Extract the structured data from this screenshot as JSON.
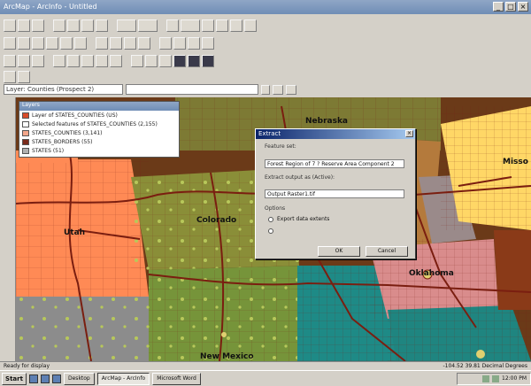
{
  "window": {
    "title": "ArcMap - ArcInfo - Untitled",
    "controls": [
      "_",
      "□",
      "×"
    ]
  },
  "toolbar": {
    "layer_selector": "Layer: Counties (Prospect 2)",
    "combo2": ""
  },
  "map_labels": {
    "nebraska": "Nebraska",
    "colorado": "Colorado",
    "utah": "Utah",
    "oklahoma": "Oklahoma",
    "new_mexico": "New Mexico",
    "missouri": "Misso"
  },
  "layers": {
    "panel_title": "Layers",
    "items": [
      {
        "label": "Layer of STATES_COUNTIES (US)",
        "color": "#d84b2a"
      },
      {
        "label": "Selected features of STATES_COUNTIES (2,155)",
        "color": "#ffffff"
      },
      {
        "label": "STATES_COUNTIES (3,141)",
        "color": "#f3a68a"
      },
      {
        "label": "STATES_BORDERS (55)",
        "color": "#7a2a1a"
      },
      {
        "label": "STATES (51)",
        "color": "#b0b0b0"
      }
    ]
  },
  "dialog": {
    "title": "Extract",
    "close": "×",
    "input_label": "Feature set:",
    "input_value": "Forest Region of 7 ? Reserve Area Component 2",
    "output_label": "Extract output as (Active):",
    "output_value": "Output Raster1.tif",
    "options_label": "Options",
    "radio1": "Export data extents",
    "radio2": "",
    "ok": "OK",
    "cancel": "Cancel"
  },
  "status": {
    "left": "Ready for display",
    "right": "-104.52  39.81 Decimal Degrees"
  },
  "taskbar": {
    "start": "Start",
    "apps": [
      {
        "label": "Desktop",
        "active": false
      },
      {
        "label": "ArcMap - ArcInfo",
        "active": true
      },
      {
        "label": "Microsoft Word",
        "active": false
      }
    ],
    "clock": "12:00 PM"
  },
  "colors": {
    "map_orange": "#ff8a55",
    "map_green": "#8a8e38",
    "map_brown": "#6b3a18",
    "map_teal": "#1e8a86",
    "map_yellow": "#ffd766",
    "map_gray": "#8c8c8c",
    "map_pink": "#d98c8c",
    "road": "#7a1e10"
  }
}
